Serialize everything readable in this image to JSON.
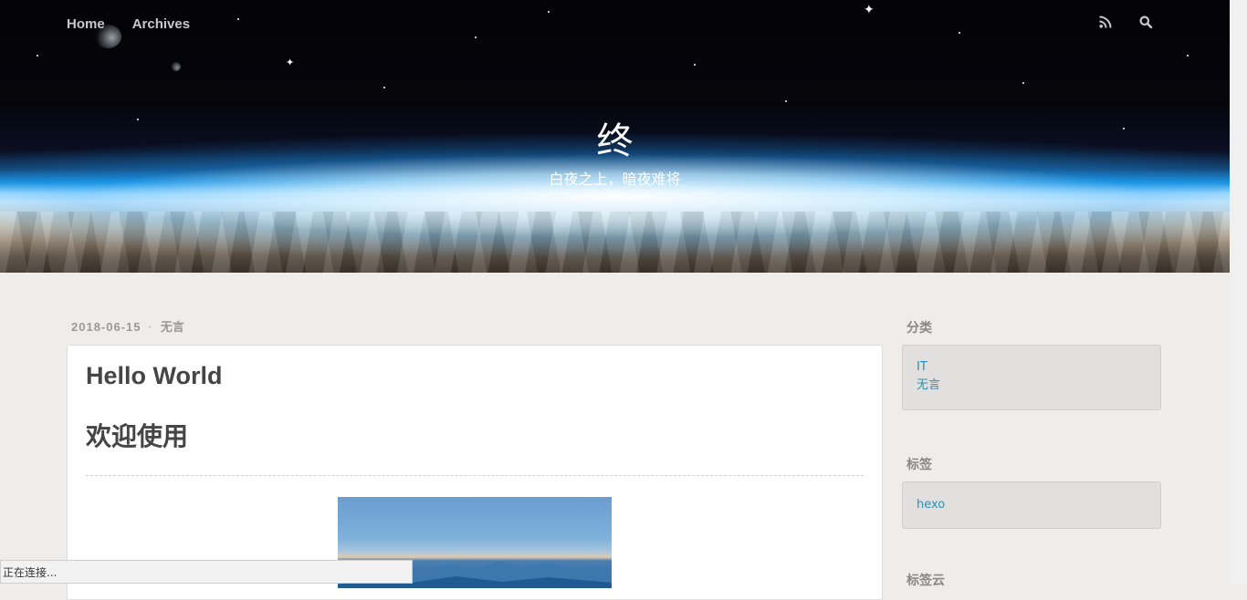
{
  "nav": {
    "items": [
      {
        "label": "Home"
      },
      {
        "label": "Archives"
      }
    ],
    "rss_icon": "rss-icon",
    "search_icon": "search-icon"
  },
  "site": {
    "title": "终",
    "subtitle": "白夜之上，暗夜难将"
  },
  "article": {
    "date": "2018-06-15",
    "category": "无言",
    "title": "Hello World",
    "heading": "欢迎使用"
  },
  "sidebar": {
    "categories": {
      "title": "分类",
      "items": [
        "IT",
        "无言"
      ]
    },
    "tags": {
      "title": "标签",
      "items": [
        "hexo"
      ]
    },
    "tag_cloud": {
      "title": "标签云"
    }
  },
  "status": {
    "text": "正在连接..."
  },
  "colors": {
    "background": "#eeedeb",
    "link": "#2a8fb6",
    "widget_bg": "#e1e0de",
    "title_text": "#454545"
  }
}
